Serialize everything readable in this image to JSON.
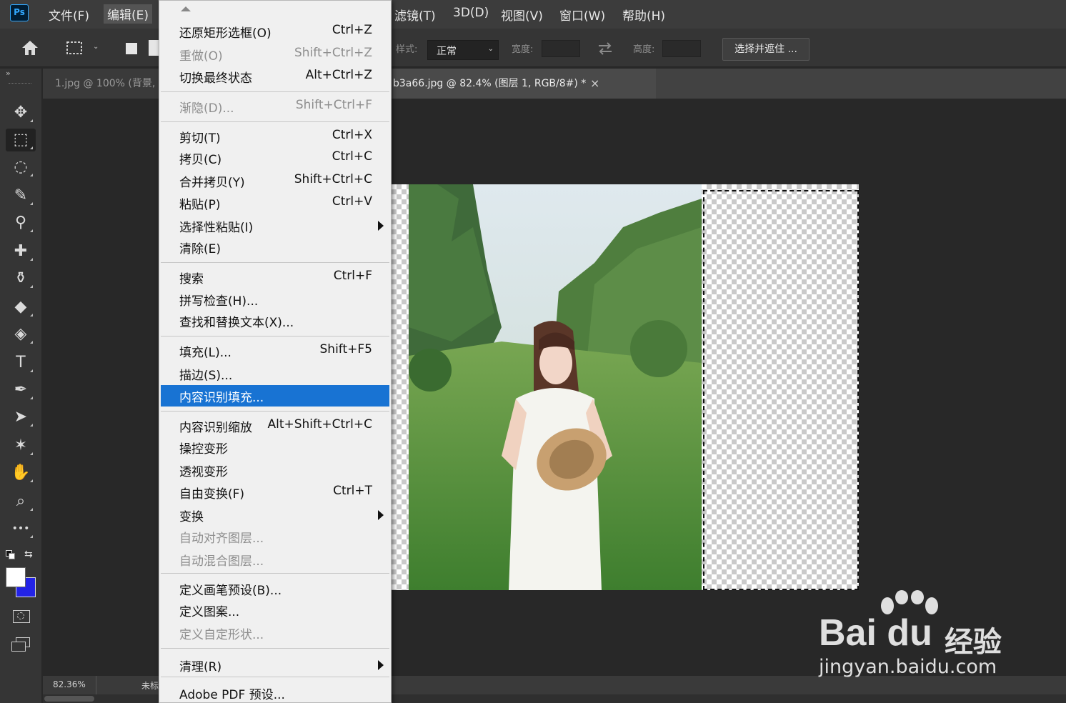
{
  "app": {
    "logo": "Ps"
  },
  "menubar": {
    "items": [
      {
        "label": "文件(F)"
      },
      {
        "label": "编辑(E)"
      },
      {
        "label": "滤镜(T)"
      },
      {
        "label": "3D(D)"
      },
      {
        "label": "视图(V)"
      },
      {
        "label": "窗口(W)"
      },
      {
        "label": "帮助(H)"
      }
    ]
  },
  "options": {
    "style_label": "样式:",
    "style_value": "正常",
    "width_label": "宽度:",
    "height_label": "高度:",
    "select_mask_button": "选择并遮住 ..."
  },
  "tabs": {
    "inactive_label": "1.jpg @ 100% (背景,",
    "active_label": "b3a66.jpg @ 82.4% (图层 1, RGB/8#) *",
    "close_glyph": "×"
  },
  "status": {
    "zoom": "82.36%",
    "doc_info": "未标"
  },
  "edit_menu": {
    "items": [
      {
        "label": "还原矩形选框(O)",
        "shortcut": "Ctrl+Z",
        "disabled": false
      },
      {
        "label": "重做(O)",
        "shortcut": "Shift+Ctrl+Z",
        "disabled": true
      },
      {
        "label": "切换最终状态",
        "shortcut": "Alt+Ctrl+Z",
        "disabled": false
      },
      {
        "label": "渐隐(D)...",
        "shortcut": "Shift+Ctrl+F",
        "disabled": true
      },
      {
        "label": "剪切(T)",
        "shortcut": "Ctrl+X",
        "disabled": false
      },
      {
        "label": "拷贝(C)",
        "shortcut": "Ctrl+C",
        "disabled": false
      },
      {
        "label": "合并拷贝(Y)",
        "shortcut": "Shift+Ctrl+C",
        "disabled": false
      },
      {
        "label": "粘贴(P)",
        "shortcut": "Ctrl+V",
        "disabled": false
      },
      {
        "label": "选择性粘贴(I)",
        "shortcut": "",
        "disabled": false,
        "submenu": true
      },
      {
        "label": "清除(E)",
        "shortcut": "",
        "disabled": false
      },
      {
        "label": "搜索",
        "shortcut": "Ctrl+F",
        "disabled": false
      },
      {
        "label": "拼写检查(H)...",
        "shortcut": "",
        "disabled": false
      },
      {
        "label": "查找和替换文本(X)...",
        "shortcut": "",
        "disabled": false
      },
      {
        "label": "填充(L)...",
        "shortcut": "Shift+F5",
        "disabled": false
      },
      {
        "label": "描边(S)...",
        "shortcut": "",
        "disabled": false
      },
      {
        "label": "内容识别填充...",
        "shortcut": "",
        "disabled": false,
        "highlighted": true
      },
      {
        "label": "内容识别缩放",
        "shortcut": "Alt+Shift+Ctrl+C",
        "disabled": false
      },
      {
        "label": "操控变形",
        "shortcut": "",
        "disabled": false
      },
      {
        "label": "透视变形",
        "shortcut": "",
        "disabled": false
      },
      {
        "label": "自由变换(F)",
        "shortcut": "Ctrl+T",
        "disabled": false
      },
      {
        "label": "变换",
        "shortcut": "",
        "disabled": false,
        "submenu": true
      },
      {
        "label": "自动对齐图层...",
        "shortcut": "",
        "disabled": true
      },
      {
        "label": "自动混合图层...",
        "shortcut": "",
        "disabled": true
      },
      {
        "label": "定义画笔预设(B)...",
        "shortcut": "",
        "disabled": false
      },
      {
        "label": "定义图案...",
        "shortcut": "",
        "disabled": false
      },
      {
        "label": "定义自定形状...",
        "shortcut": "",
        "disabled": true
      },
      {
        "label": "清理(R)",
        "shortcut": "",
        "disabled": false,
        "submenu": true
      },
      {
        "label": "Adobe PDF 预设...",
        "shortcut": "",
        "disabled": false
      }
    ]
  },
  "tools": [
    {
      "name": "move-tool-icon",
      "glyph": "✥"
    },
    {
      "name": "rect-marquee-tool-icon",
      "glyph": "⬚"
    },
    {
      "name": "lasso-tool-icon",
      "glyph": "◌"
    },
    {
      "name": "quick-select-tool-icon",
      "glyph": "✎"
    },
    {
      "name": "eyedropper-tool-icon",
      "glyph": "⚲"
    },
    {
      "name": "healing-brush-tool-icon",
      "glyph": "✚"
    },
    {
      "name": "clone-stamp-tool-icon",
      "glyph": "⚱"
    },
    {
      "name": "eraser-tool-icon",
      "glyph": "◆"
    },
    {
      "name": "paint-bucket-tool-icon",
      "glyph": "◈"
    },
    {
      "name": "type-tool-icon",
      "glyph": "T"
    },
    {
      "name": "pen-tool-icon",
      "glyph": "✒"
    },
    {
      "name": "path-select-tool-icon",
      "glyph": "➤"
    },
    {
      "name": "custom-shape-tool-icon",
      "glyph": "✶"
    },
    {
      "name": "hand-tool-icon",
      "glyph": "✋"
    },
    {
      "name": "zoom-tool-icon",
      "glyph": "⌕"
    },
    {
      "name": "more-tools-icon",
      "glyph": "•••"
    }
  ],
  "colors": {
    "foreground": "#ffffff",
    "background": "#2323e6",
    "highlight": "#1873d3"
  },
  "watermark": {
    "brand": "Bai du",
    "product": "经验",
    "url": "jingyan.baidu.com"
  }
}
